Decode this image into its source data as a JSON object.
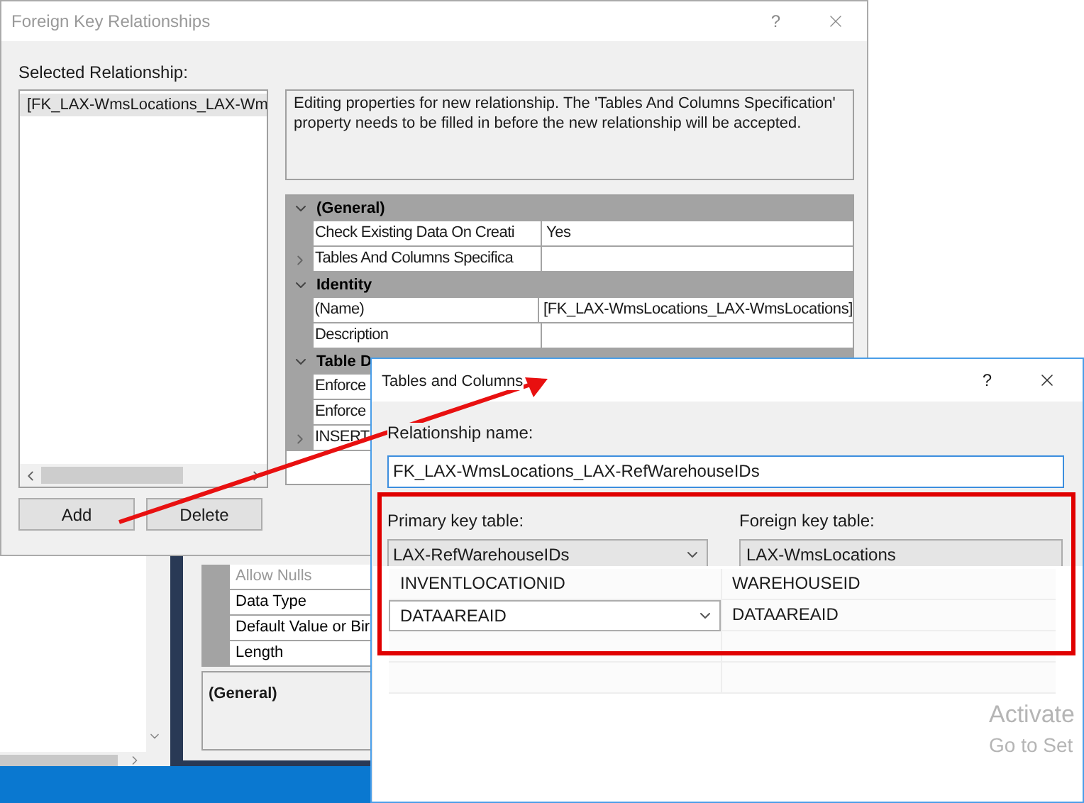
{
  "fk_dialog": {
    "title": "Foreign Key Relationships",
    "help": "?",
    "selected_label": "Selected Relationship:",
    "relationships": [
      {
        "label": "[FK_LAX-WmsLocations_LAX-Wm",
        "selected": true
      }
    ],
    "description": "Editing properties for new relationship.  The 'Tables And Columns Specification' property needs to be filled in before the new relationship will be accepted.",
    "properties": [
      {
        "category": "(General)",
        "expanded": true,
        "rows": [
          {
            "name": "Check Existing Data On Creati",
            "value": "Yes",
            "expandable": false
          },
          {
            "name": "Tables And Columns Specifica",
            "expandable": true
          }
        ]
      },
      {
        "category": "Identity",
        "expanded": true,
        "rows": [
          {
            "name": "(Name)",
            "value": "[FK_LAX-WmsLocations_LAX-WmsLocations]",
            "expandable": false
          },
          {
            "name": "Description",
            "expandable": false
          }
        ]
      },
      {
        "category": "Table D",
        "expanded": true,
        "rows": [
          {
            "name": "Enforce",
            "expandable": false
          },
          {
            "name": "Enforce",
            "expandable": false
          },
          {
            "name": "INSERT",
            "expandable": true
          }
        ]
      }
    ],
    "buttons": [
      "Add",
      "Delete"
    ]
  },
  "designer": {
    "properties": [
      {
        "name": "Allow Nulls",
        "disabled": true
      },
      {
        "name": "Data Type",
        "disabled": false
      },
      {
        "name": "Default Value or Bir",
        "disabled": false
      },
      {
        "name": "Length",
        "disabled": false
      }
    ],
    "section": "(General)"
  },
  "tc_dialog": {
    "title": "Tables and Columns",
    "help": "?",
    "relationship_label": "Relationship name:",
    "relationship_name": "FK_LAX-WmsLocations_LAX-RefWarehouseIDs",
    "primary_label": "Primary key table:",
    "foreign_label": "Foreign key table:",
    "primary_table": "LAX-RefWarehouseIDs",
    "foreign_table": "LAX-WmsLocations",
    "columns": [
      {
        "primary": "INVENTLOCATIONID",
        "foreign": "WAREHOUSEID",
        "kind": "text"
      },
      {
        "primary": "DATAAREAID",
        "foreign": "DATAAREAID",
        "kind": "dropdown"
      }
    ]
  },
  "activation": {
    "title": "Activate",
    "subtitle": "Go to Set"
  }
}
